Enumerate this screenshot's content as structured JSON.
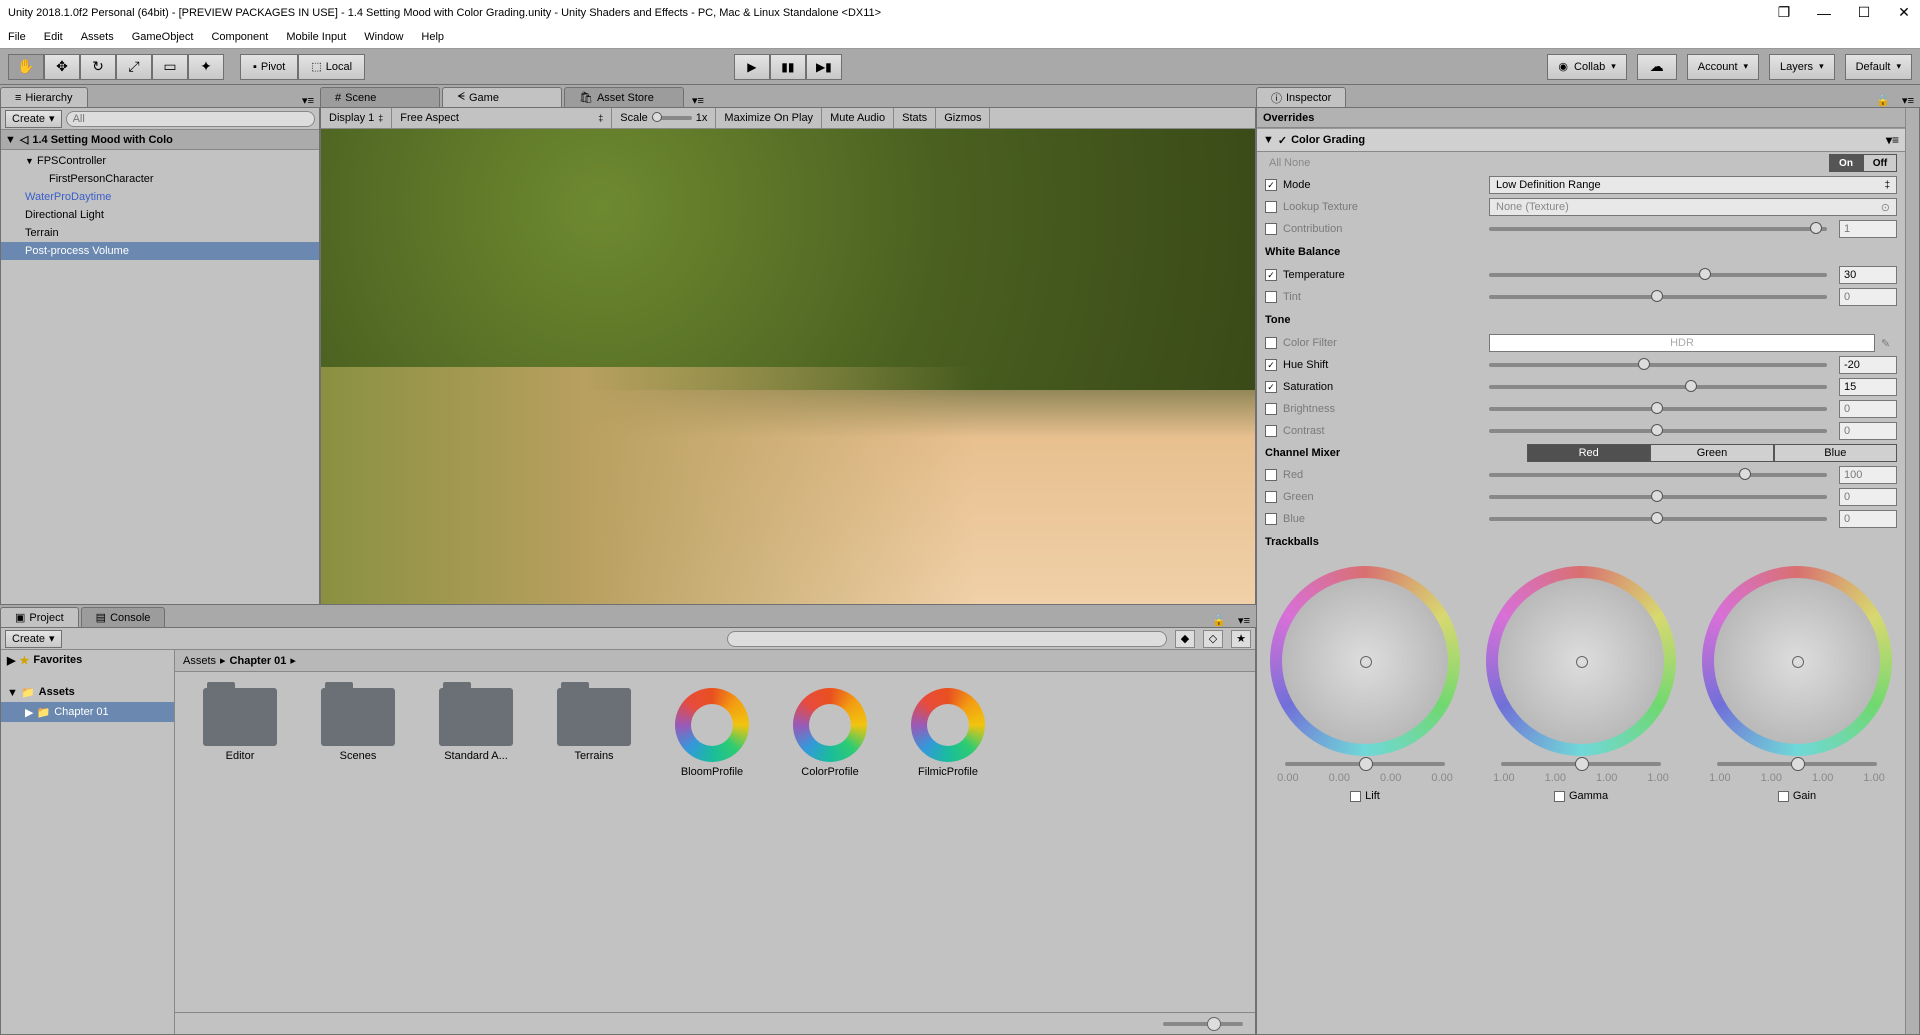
{
  "window": {
    "title": "Unity 2018.1.0f2 Personal (64bit) - [PREVIEW PACKAGES IN USE] - 1.4 Setting Mood with Color Grading.unity - Unity Shaders and Effects - PC, Mac & Linux Standalone <DX11>"
  },
  "menubar": [
    "File",
    "Edit",
    "Assets",
    "GameObject",
    "Component",
    "Mobile Input",
    "Window",
    "Help"
  ],
  "toolbar": {
    "pivot": "Pivot",
    "local": "Local",
    "collab": "Collab",
    "account": "Account",
    "layers": "Layers",
    "default": "Default"
  },
  "hierarchy": {
    "tab": "Hierarchy",
    "create": "Create",
    "search_ph": "All",
    "scene": "1.4 Setting Mood with Colo",
    "items": [
      {
        "label": "FPSController",
        "indent": 0,
        "arrow": true
      },
      {
        "label": "FirstPersonCharacter",
        "indent": 1
      },
      {
        "label": "WaterProDaytime",
        "indent": 0,
        "blue": true
      },
      {
        "label": "Directional Light",
        "indent": 0
      },
      {
        "label": "Terrain",
        "indent": 0
      },
      {
        "label": "Post-process Volume",
        "indent": 0,
        "sel": true
      }
    ]
  },
  "center": {
    "tabs": [
      "Scene",
      "Game",
      "Asset Store"
    ],
    "display": "Display 1",
    "aspect": "Free Aspect",
    "scale": "Scale",
    "scaleval": "1x",
    "maxplay": "Maximize On Play",
    "mute": "Mute Audio",
    "stats": "Stats",
    "gizmos": "Gizmos"
  },
  "project": {
    "tabs": [
      "Project",
      "Console"
    ],
    "create": "Create",
    "favorites": "Favorites",
    "assets": "Assets",
    "chapter": "Chapter 01",
    "breadcrumb": [
      "Assets",
      "Chapter 01"
    ],
    "grid": [
      {
        "type": "folder",
        "label": "Editor"
      },
      {
        "type": "folder",
        "label": "Scenes"
      },
      {
        "type": "folder",
        "label": "Standard A..."
      },
      {
        "type": "folder",
        "label": "Terrains"
      },
      {
        "type": "profile",
        "label": "BloomProfile"
      },
      {
        "type": "profile",
        "label": "ColorProfile"
      },
      {
        "type": "profile",
        "label": "FilmicProfile"
      }
    ]
  },
  "inspector": {
    "tab": "Inspector",
    "overrides": "Overrides",
    "component": "Color Grading",
    "all": "All",
    "none": "None",
    "on": "On",
    "off": "Off",
    "mode": {
      "label": "Mode",
      "value": "Low Definition Range",
      "checked": true
    },
    "lut": {
      "label": "Lookup Texture",
      "value": "None (Texture)"
    },
    "contribution": {
      "label": "Contribution",
      "value": "1"
    },
    "whitebalance": "White Balance",
    "temperature": {
      "label": "Temperature",
      "value": "30",
      "pos": 62,
      "checked": true
    },
    "tint": {
      "label": "Tint",
      "value": "0",
      "pos": 50
    },
    "tone": "Tone",
    "colorfilter": {
      "label": "Color Filter",
      "value": "HDR"
    },
    "hueshift": {
      "label": "Hue Shift",
      "value": "-20",
      "pos": 44,
      "checked": true
    },
    "saturation": {
      "label": "Saturation",
      "value": "15",
      "pos": 58,
      "checked": true
    },
    "brightness": {
      "label": "Brightness",
      "value": "0",
      "pos": 50
    },
    "contrast": {
      "label": "Contrast",
      "value": "0",
      "pos": 50
    },
    "channelmixer": "Channel Mixer",
    "channels": [
      "Red",
      "Green",
      "Blue"
    ],
    "red": {
      "label": "Red",
      "value": "100",
      "pos": 75
    },
    "green": {
      "label": "Green",
      "value": "0",
      "pos": 50
    },
    "blue": {
      "label": "Blue",
      "value": "0",
      "pos": 50
    },
    "trackballs": "Trackballs",
    "tb": [
      {
        "label": "Lift",
        "vals": [
          "0.00",
          "0.00",
          "0.00",
          "0.00"
        ]
      },
      {
        "label": "Gamma",
        "vals": [
          "1.00",
          "1.00",
          "1.00",
          "1.00"
        ]
      },
      {
        "label": "Gain",
        "vals": [
          "1.00",
          "1.00",
          "1.00",
          "1.00"
        ]
      }
    ]
  }
}
